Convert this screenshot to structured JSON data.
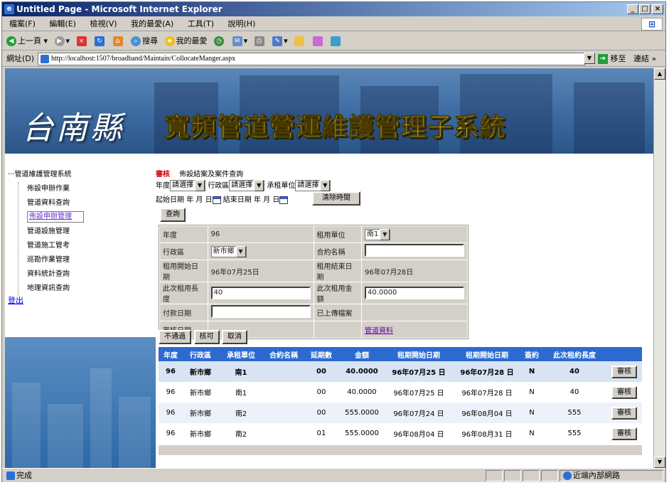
{
  "window": {
    "title": "Untitled Page - Microsoft Internet Explorer"
  },
  "menu": [
    "檔案(F)",
    "編輯(E)",
    "檢視(V)",
    "我的最愛(A)",
    "工具(T)",
    "說明(H)"
  ],
  "toolbar": {
    "back": "上一頁",
    "search": "搜尋",
    "favorites": "我的最愛"
  },
  "address": {
    "label": "網址(D)",
    "url": "http://localhost:1507/broadband/Maintain/CollocateManger.aspx",
    "go": "移至",
    "links": "連結"
  },
  "banner": {
    "county": "台南縣",
    "system": "寬頻管道營運維護管理子系統"
  },
  "sidebar": {
    "root": "管道維護管理系統",
    "items": [
      "佈設申辦作業",
      "管道資料查詢",
      "佈設申辦管理",
      "管道設施管理",
      "管道施工管考",
      "巡勘作業管理",
      "資料統計查詢",
      "地理資訊查詢"
    ],
    "logout": "登出"
  },
  "tabs": {
    "active": "審核",
    "other": "佈設結案及案件查詢"
  },
  "filters": {
    "year_label": "年度",
    "year_value": "請選擇",
    "district_label": "行政區",
    "district_value": "請選擇",
    "lessee_label": "承租單位",
    "lessee_value": "請選擇",
    "start_label": "起始日期",
    "end_label": "結束日期",
    "y": "年",
    "m": "月",
    "d": "日",
    "clear": "清除時間",
    "query": "查詢"
  },
  "detail": {
    "year_label": "年度",
    "year_value": "96",
    "unit_label": "租用單位",
    "unit_value": "南1",
    "district_label": "行政區",
    "district_value": "新市鄉",
    "contract_label": "合約名稱",
    "contract_value": "",
    "start_label": "租用開始日期",
    "start_value": "96年07月25日",
    "end_label": "租用結束日期",
    "end_value": "96年07月28日",
    "length_label": "此次租用長度",
    "length_value": "40",
    "amount_label": "此次租用金額",
    "amount_value": "40.0000",
    "pay_label": "付款日期",
    "pay_value": "",
    "upload_label": "已上傳檔案",
    "review_label": "審核日期",
    "pipe_link": "管道資料"
  },
  "actions": {
    "reject": "不通過",
    "approve": "核可",
    "cancel": "取消"
  },
  "grid": {
    "headers": [
      "年度",
      "行政區",
      "承租單位",
      "合約名稱",
      "延期數",
      "金額",
      "租期開始日期",
      "租期開始日期",
      "簽約",
      "此次租約長度",
      ""
    ],
    "review_label": "審核",
    "rows": [
      [
        "96",
        "新市鄉",
        "南1",
        "",
        "00",
        "40.0000",
        "96年07月25 日",
        "96年07月28 日",
        "N",
        "40"
      ],
      [
        "96",
        "新市鄉",
        "南1",
        "",
        "00",
        "40.0000",
        "96年07月25 日",
        "96年07月28 日",
        "N",
        "40"
      ],
      [
        "96",
        "新市鄉",
        "南2",
        "",
        "00",
        "555.0000",
        "96年07月24 日",
        "96年08月04 日",
        "N",
        "555"
      ],
      [
        "96",
        "新市鄉",
        "南2",
        "",
        "01",
        "555.0000",
        "96年08月04 日",
        "96年08月31 日",
        "N",
        "555"
      ]
    ]
  },
  "status": {
    "left": "完成",
    "zone": "近端內部網路"
  }
}
